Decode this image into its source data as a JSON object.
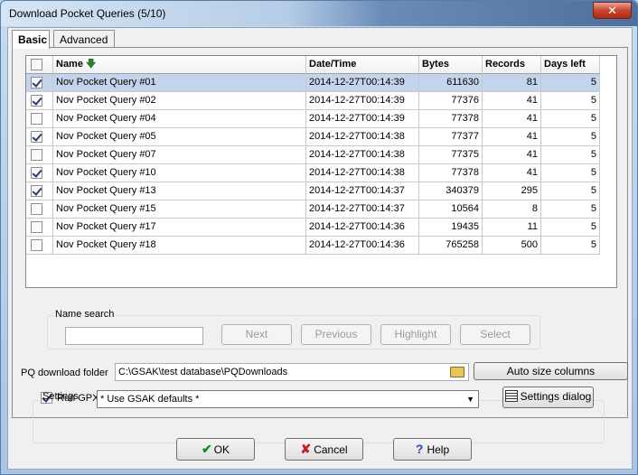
{
  "window": {
    "title": "Download Pocket Queries   (5/10)",
    "close_label": "✕"
  },
  "tabs": [
    {
      "label": "Basic",
      "active": true
    },
    {
      "label": "Advanced",
      "active": false
    }
  ],
  "grid": {
    "columns": [
      "Name",
      "Date/Time",
      "Bytes",
      "Records",
      "Days left"
    ],
    "rows": [
      {
        "checked": true,
        "name": "Nov Pocket Query #01",
        "datetime": "2014-12-27T00:14:39",
        "bytes": "611630",
        "records": "81",
        "days": "5",
        "selected": true
      },
      {
        "checked": true,
        "name": "Nov Pocket Query #02",
        "datetime": "2014-12-27T00:14:39",
        "bytes": "77376",
        "records": "41",
        "days": "5",
        "selected": false
      },
      {
        "checked": false,
        "name": "Nov Pocket Query #04",
        "datetime": "2014-12-27T00:14:39",
        "bytes": "77378",
        "records": "41",
        "days": "5",
        "selected": false
      },
      {
        "checked": true,
        "name": "Nov Pocket Query #05",
        "datetime": "2014-12-27T00:14:38",
        "bytes": "77377",
        "records": "41",
        "days": "5",
        "selected": false
      },
      {
        "checked": false,
        "name": "Nov Pocket Query #07",
        "datetime": "2014-12-27T00:14:38",
        "bytes": "77375",
        "records": "41",
        "days": "5",
        "selected": false
      },
      {
        "checked": true,
        "name": "Nov Pocket Query #10",
        "datetime": "2014-12-27T00:14:38",
        "bytes": "77378",
        "records": "41",
        "days": "5",
        "selected": false
      },
      {
        "checked": true,
        "name": "Nov Pocket Query #13",
        "datetime": "2014-12-27T00:14:37",
        "bytes": "340379",
        "records": "295",
        "days": "5",
        "selected": false
      },
      {
        "checked": false,
        "name": "Nov Pocket Query #15",
        "datetime": "2014-12-27T00:14:37",
        "bytes": "10564",
        "records": "8",
        "days": "5",
        "selected": false
      },
      {
        "checked": false,
        "name": "Nov Pocket Query #17",
        "datetime": "2014-12-27T00:14:36",
        "bytes": "19435",
        "records": "11",
        "days": "5",
        "selected": false
      },
      {
        "checked": false,
        "name": "Nov Pocket Query #18",
        "datetime": "2014-12-27T00:14:36",
        "bytes": "765258",
        "records": "500",
        "days": "5",
        "selected": false
      }
    ]
  },
  "name_search": {
    "legend": "Name search",
    "value": "",
    "buttons": [
      "Next",
      "Previous",
      "Highlight",
      "Select"
    ]
  },
  "download_folder": {
    "label": "PQ download folder",
    "value": "C:\\GSAK\\test database\\PQDownloads",
    "auto_size_label": "Auto size columns"
  },
  "gpx_load": {
    "checkbox_label": "Run GPX load after download",
    "checked": true,
    "settings_label": "Settings",
    "settings_value": "* Use GSAK defaults *",
    "settings_dialog_label": "Settings dialog"
  },
  "footer": {
    "ok_label": "OK",
    "cancel_label": "Cancel",
    "help_label": "Help"
  },
  "colors": {
    "selection": "#c3d4ec",
    "close_button": "#c7452f"
  }
}
